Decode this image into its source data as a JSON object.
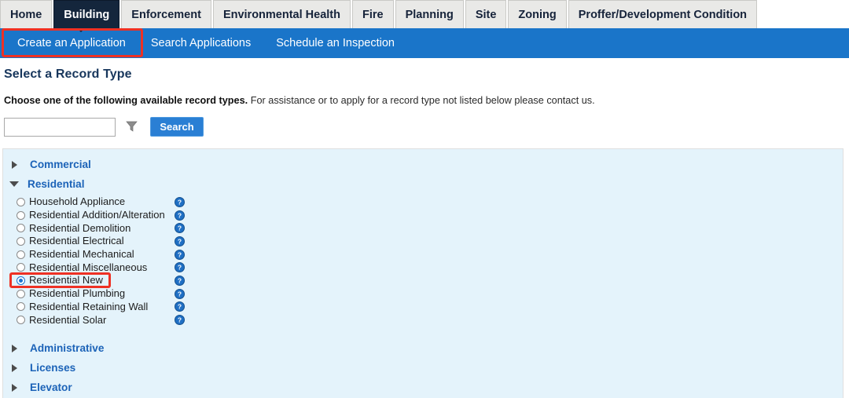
{
  "tabs": [
    {
      "label": "Home",
      "active": false
    },
    {
      "label": "Building",
      "active": true
    },
    {
      "label": "Enforcement",
      "active": false
    },
    {
      "label": "Environmental Health",
      "active": false
    },
    {
      "label": "Fire",
      "active": false
    },
    {
      "label": "Planning",
      "active": false
    },
    {
      "label": "Site",
      "active": false
    },
    {
      "label": "Zoning",
      "active": false
    },
    {
      "label": "Proffer/Development Condition",
      "active": false
    }
  ],
  "subnav": {
    "items": [
      {
        "label": "Create an Application",
        "selected": true
      },
      {
        "label": "Search Applications",
        "selected": false
      },
      {
        "label": "Schedule an Inspection",
        "selected": false
      }
    ]
  },
  "page": {
    "title": "Select a Record Type",
    "instruction_bold": "Choose one of the following available record types.",
    "instruction_rest": " For assistance or to apply for a record type not listed below please contact us."
  },
  "search": {
    "value": "",
    "placeholder": "",
    "filter_icon": "funnel-icon",
    "button_label": "Search"
  },
  "record_types": {
    "groups": [
      {
        "label": "Commercial",
        "expanded": false,
        "arrow": "chevron-right-icon"
      },
      {
        "label": "Residential",
        "expanded": true,
        "arrow": "chevron-down-icon"
      },
      {
        "label": "Administrative",
        "expanded": false,
        "arrow": "chevron-right-icon"
      },
      {
        "label": "Licenses",
        "expanded": false,
        "arrow": "chevron-right-icon"
      },
      {
        "label": "Elevator",
        "expanded": false,
        "arrow": "chevron-right-icon"
      }
    ],
    "residential_items": [
      {
        "label": "Household Appliance",
        "selected": false,
        "help": "help-icon"
      },
      {
        "label": "Residential Addition/Alteration",
        "selected": false,
        "help": "help-icon"
      },
      {
        "label": "Residential Demolition",
        "selected": false,
        "help": "help-icon"
      },
      {
        "label": "Residential Electrical",
        "selected": false,
        "help": "help-icon"
      },
      {
        "label": "Residential Mechanical",
        "selected": false,
        "help": "help-icon"
      },
      {
        "label": "Residential Miscellaneous",
        "selected": false,
        "help": "help-icon"
      },
      {
        "label": "Residential New",
        "selected": true,
        "help": "help-icon"
      },
      {
        "label": "Residential Plumbing",
        "selected": false,
        "help": "help-icon"
      },
      {
        "label": "Residential Retaining Wall",
        "selected": false,
        "help": "help-icon"
      },
      {
        "label": "Residential Solar",
        "selected": false,
        "help": "help-icon"
      }
    ]
  },
  "annotations": [
    {
      "name": "highlight-create-an-application",
      "color": "#ee3124"
    },
    {
      "name": "highlight-residential-new",
      "color": "#ee3124"
    }
  ],
  "colors": {
    "active_tab_bg": "#14263c",
    "subnav_bg": "#1a75c9",
    "panel_bg": "#e4f3fb",
    "link_blue": "#1c63b8",
    "title_navy": "#17365c",
    "annotation_red": "#ee3124",
    "button_blue": "#2a7fd4"
  }
}
